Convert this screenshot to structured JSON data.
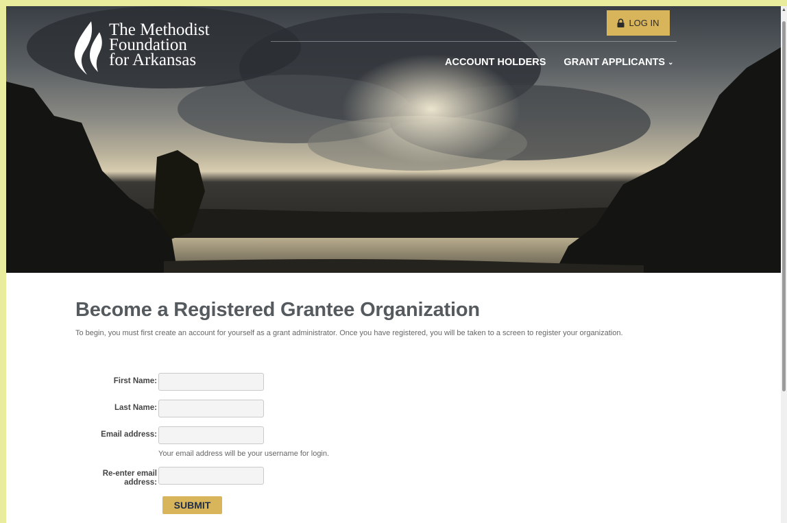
{
  "header": {
    "logo_lines": [
      "The Methodist",
      "Foundation",
      "for Arkansas"
    ],
    "login_label": "LOG IN",
    "nav": [
      {
        "label": "ACCOUNT HOLDERS"
      },
      {
        "label": "GRANT APPLICANTS"
      }
    ]
  },
  "page": {
    "title": "Become a Registered Grantee Organization",
    "intro": "To begin, you must first create an account for yourself as a grant administrator. Once you have registered, you will be taken to a screen to register your organization."
  },
  "form": {
    "first_name_label": "First Name:",
    "last_name_label": "Last Name:",
    "email_label": "Email address:",
    "email_hint": "Your email address will be your username for login.",
    "reenter_label_1": "Re-enter email",
    "reenter_label_2": "address:",
    "first_name_value": "",
    "last_name_value": "",
    "email_value": "",
    "reenter_value": "",
    "submit_label": "SUBMIT"
  },
  "colors": {
    "accent": "#d8b55a",
    "heading": "#555a5e",
    "outer": "#e8ec9c"
  }
}
